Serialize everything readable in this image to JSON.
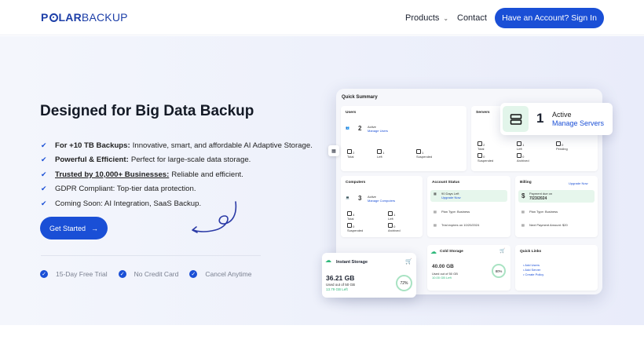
{
  "header": {
    "logo": {
      "part1": "P",
      "part2": "LAR",
      "part3": "BACKUP"
    },
    "nav": {
      "products": "Products",
      "contact": "Contact"
    },
    "signin": "Have an Account? Sign In"
  },
  "hero": {
    "title": "Designed for Big Data Backup",
    "features": [
      {
        "bold": "For +10 TB Backups:",
        "text": "Innovative, smart, and affordable AI Adaptive Storage."
      },
      {
        "bold": "Powerful & Efficient:",
        "text": "Perfect for large-scale data storage."
      },
      {
        "bold": "Trusted by 10,000+ Businesses:",
        "text": "Reliable and efficient."
      },
      {
        "bold": "",
        "text": "GDPR Compliant: Top-tier data protection."
      },
      {
        "bold": "",
        "text": "Coming Soon: AI Integration, SaaS Backup."
      }
    ],
    "cta": "Get Started",
    "badges": [
      "15-Day Free Trial",
      "No Credit Card",
      "Cancel Anytime"
    ]
  },
  "dashboard": {
    "title": "Quick Summary",
    "users": {
      "title": "Users",
      "count": "2",
      "status": "Active",
      "link": "Manage Users",
      "total": "2",
      "total_label": "Total",
      "left": "1",
      "left_label": "Left",
      "suspended": "1",
      "suspended_label": "Suspended"
    },
    "servers": {
      "title": "Servers",
      "count": "1",
      "status": "Active",
      "link": "Manage Servers",
      "total": "2",
      "total_label": "Total",
      "left": "1",
      "left_label": "Left",
      "pending": "0",
      "pending_label": "Pending",
      "suspended": "0",
      "suspended_label": "Suspended",
      "archived": "0",
      "archived_label": "Archived"
    },
    "computers": {
      "title": "Computers",
      "count": "3",
      "status": "Active",
      "link": "Manage Computers",
      "total": "4",
      "total_label": "Total",
      "left": "1",
      "left_label": "Left",
      "suspended": "0",
      "suspended_label": "Suspended",
      "archived": "0",
      "archived_label": "Archived"
    },
    "account": {
      "title": "Account Status",
      "days": "90 Days Left",
      "upgrade": "Upgrade Now",
      "plan": "Plan Type: Business",
      "trial": "Trial expires on 10/20/2024"
    },
    "billing": {
      "title": "Billing",
      "upgrade": "Upgrade Now",
      "due_label": "Payment due on",
      "due_date": "7/23/2024",
      "plan": "Plan Type: Business",
      "amount": "Next Payment Amount: $20"
    },
    "instant": {
      "title": "Instant Storage",
      "size": "36.21 GB",
      "used": "Used out of 50 GB",
      "left": "13.79 GB Left",
      "percent": "72%",
      "percent_value": 72
    },
    "cold": {
      "title": "Cold Storage",
      "size": "40.00 GB",
      "used": "Used out of 50 GB",
      "left": "10.00 GB Left",
      "percent": "80%",
      "percent_value": 80
    },
    "quick_links": {
      "title": "Quick Links",
      "items": [
        "Add Users",
        "Add Server",
        "Create Policy"
      ]
    }
  },
  "colors": {
    "brand": "#1a4fd6",
    "accent_green": "#2db87a"
  }
}
